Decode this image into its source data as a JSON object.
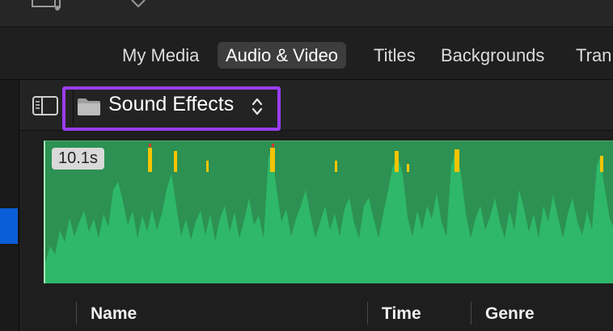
{
  "tabs": [
    {
      "label": "My Media",
      "active": false
    },
    {
      "label": "Audio & Video",
      "active": true
    },
    {
      "label": "Titles",
      "active": false
    },
    {
      "label": "Backgrounds",
      "active": false
    },
    {
      "label": "Tran",
      "active": false
    }
  ],
  "library": {
    "label": "Sound Effects",
    "icon": "folder-icon"
  },
  "clip": {
    "duration": "10.1s"
  },
  "columns": [
    "Name",
    "Time",
    "Genre"
  ],
  "colors": {
    "accent_highlight": "#9b3cf0",
    "selection": "#0a5fd8",
    "waveform_bg": "#2c9152",
    "waveform": "#2fb869",
    "peak": "#f6c400"
  }
}
